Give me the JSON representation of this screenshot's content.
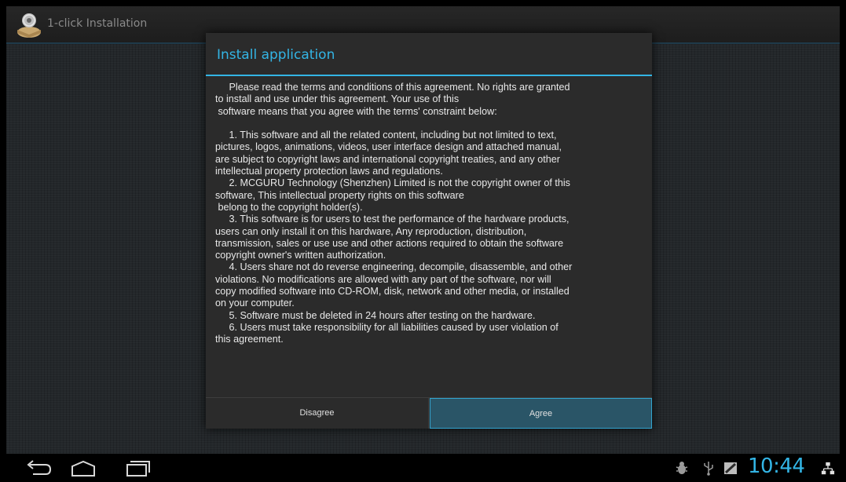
{
  "action_bar": {
    "title": "1-click Installation"
  },
  "dialog": {
    "title": "Install application",
    "body": "     Please read the terms and conditions of this agreement. No rights are granted\nto install and use under this agreement. Your use of this\n software means that you agree with the terms' constraint below:\n\n     1. This software and all the related content, including but not limited to text,\npictures, logos, animations, videos, user interface design and attached manual,\nare subject to copyright laws and international copyright treaties, and any other\nintellectual property protection laws and regulations.\n     2. MCGURU Technology (Shenzhen) Limited is not the copyright owner of this\nsoftware, This intellectual property rights on this software\n belong to the copyright holder(s).\n     3. This software is for users to test the performance of the hardware products,\nusers can only install it on this hardware, Any reproduction, distribution,\ntransmission, sales or use use and other actions required to obtain the software\ncopyright owner's written authorization.\n     4. Users share not do reverse engineering, decompile, disassemble, and other\nviolations. No modifications are allowed with any part of the software, nor will\ncopy modified software into CD-ROM, disk, network and other media, or installed\non your computer.\n     5. Software must be deleted in 24 hours after testing on the hardware.\n     6. Users must take responsibility for all liabilities caused by user violation of\nthis agreement.",
    "buttons": {
      "disagree": "Disagree",
      "agree": "Agree"
    }
  },
  "system_bar": {
    "clock": "10:44",
    "nav_icons": [
      "back-icon",
      "home-icon",
      "recents-icon"
    ],
    "status_icons": [
      "usb-debugging-icon",
      "usb-icon",
      "notification-icon",
      "network-icon"
    ]
  },
  "colors": {
    "accent": "#33b5e5",
    "dialog_bg": "#2b2b2b",
    "agree_bg": "#2a5567"
  }
}
